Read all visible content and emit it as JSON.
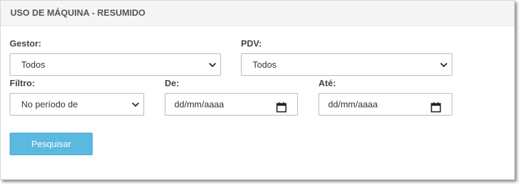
{
  "panel": {
    "title": "USO DE MÁQUINA - RESUMIDO"
  },
  "form": {
    "gestor": {
      "label": "Gestor:",
      "value": "Todos"
    },
    "pdv": {
      "label": "PDV:",
      "value": "Todos"
    },
    "filtro": {
      "label": "Filtro:",
      "value": "No período de"
    },
    "de": {
      "label": "De:",
      "placeholder": "dd/mm/aaaa"
    },
    "ate": {
      "label": "Até:",
      "placeholder": "dd/mm/aaaa"
    },
    "search_label": "Pesquisar"
  },
  "icons": {
    "select": "chevron-down-icon",
    "date": "calendar-icon"
  },
  "colors": {
    "button": "#5bb8df",
    "header_bg": "#f5f5f5"
  }
}
